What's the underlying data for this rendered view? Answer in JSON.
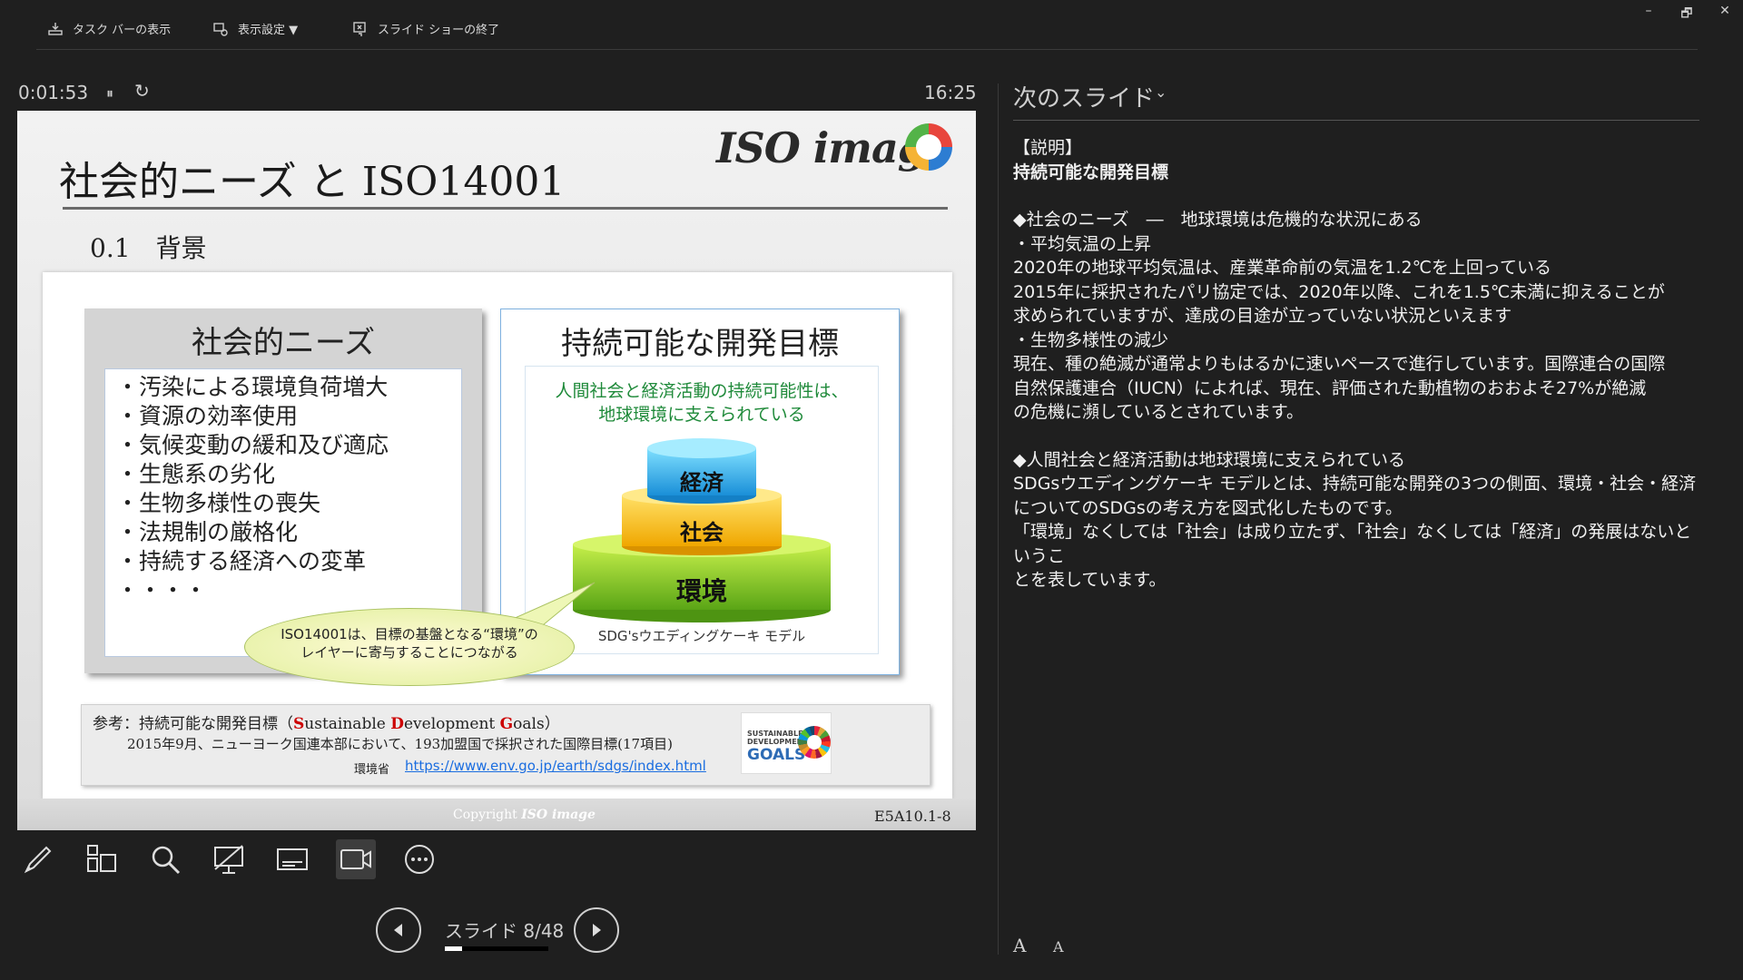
{
  "topbar": {
    "taskbar_label": "タスク バーの表示",
    "display_settings_label": "表示設定 ▼",
    "end_show_label": "スライド ショーの終了",
    "minimize": "–",
    "restore": "🗗",
    "close": "✕"
  },
  "presenter": {
    "elapsed": "0:01:53",
    "pause_glyph": "⏸",
    "restart_glyph": "↻",
    "clock": "16:25"
  },
  "slide": {
    "title": "社会的ニーズ と ISO14001",
    "logo_text": "ISO image",
    "subtitle": "0.1　背景",
    "left_box": {
      "title": "社会的ニーズ",
      "items": [
        "・汚染による環境負荷増大",
        "・資源の効率使用",
        "・気候変動の緩和及び適応",
        "・生態系の劣化",
        "・生物多様性の喪失",
        "・法規制の厳格化",
        "・持続する経済への変革",
        "・・・・"
      ]
    },
    "right_box": {
      "title": "持続可能な開発目標",
      "green_line1": "人間社会と経済活動の持続可能性は、",
      "green_line2": "地球環境に支えられている",
      "tier_top": "経済",
      "tier_mid": "社会",
      "tier_bottom": "環境",
      "caption": "SDG'sウエディングケーキ モデル"
    },
    "bubble_line1": "ISO14001は、目標の基盤となる“環境”の",
    "bubble_line2": "レイヤーに寄与することにつながる",
    "reference": {
      "prefix": "参考：持続可能な開発目標（",
      "s": "S",
      "ustainable": "ustainable ",
      "d": "D",
      "evelopment": "evelopment ",
      "g": "G",
      "oals": "oals",
      "suffix": "）",
      "line2": "2015年9月、ニューヨーク国連本部において、193加盟国で採択された国際目標(17項目)",
      "ministry": "環境省",
      "link": "https://www.env.go.jp/earth/sdgs/index.html",
      "goals_small": "SUSTAINABLE\nDEVELOPMENT",
      "goals_big": "GOALS"
    },
    "copyright": "Copyright",
    "copyright_logo": "ISO image",
    "code": "E5A10.1-8"
  },
  "navigation": {
    "label": "スライド 8/48",
    "progress": 0.167
  },
  "next_slide": {
    "title": "次のスライド",
    "chevron": "⌄"
  },
  "notes": {
    "l1": "【説明】",
    "l2": "持続可能な開発目標",
    "l3": "◆社会のニーズ　―　地球環境は危機的な状況にある",
    "l4": "・平均気温の上昇",
    "l5": "2020年の地球平均気温は、産業革命前の気温を1.2℃を上回っている",
    "l6": "2015年に採択されたパリ協定では、2020年以降、これを1.5℃未満に抑えることが",
    "l7": "求められていますが、達成の目途が立っていない状況といえます",
    "l8": "・生物多様性の減少",
    "l9": "現在、種の絶滅が通常よりもはるかに速いペースで進行しています。国際連合の国際",
    "l10": "自然保護連合（IUCN）によれば、現在、評価された動植物のおおよそ27%が絶滅",
    "l11": "の危機に瀕しているとされています。",
    "l12": "◆人間社会と経済活動は地球環境に支えられている",
    "l13": "SDGsウエディングケーキ モデルとは、持続可能な開発の3つの側面、環境・社会・経済",
    "l14": "についてのSDGsの考え方を図式化したものです。",
    "l15": "「環境」なくしては「社会」は成り立たず、「社会」なくしては「経済」の発展はないというこ",
    "l16": "とを表しています。"
  },
  "font_controls": {
    "increase": "A",
    "decrease": "A"
  }
}
